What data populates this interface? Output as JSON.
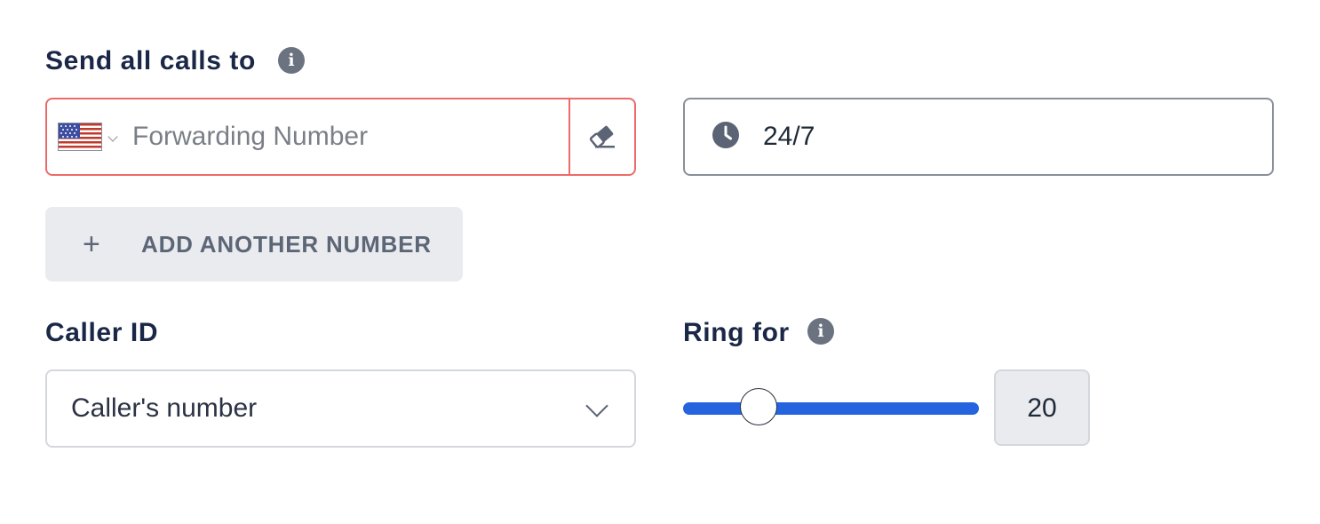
{
  "forwarding": {
    "section_label": "Send all calls to",
    "info_icon": "info-icon",
    "country_flag": "us-flag",
    "number_placeholder": "Forwarding Number",
    "number_value": "",
    "clear_icon": "eraser-icon",
    "error_border_color": "#ec6b6b"
  },
  "schedule": {
    "icon": "clock-icon",
    "value": "24/7"
  },
  "add_number": {
    "icon": "plus-icon",
    "plus_glyph": "+",
    "label": "ADD ANOTHER NUMBER"
  },
  "caller_id": {
    "label": "Caller ID",
    "selected": "Caller's number",
    "chevron_icon": "chevron-down-icon"
  },
  "ring_for": {
    "label": "Ring for",
    "info_icon": "info-icon",
    "value": "20",
    "slider_fraction": 0.26,
    "accent_color": "#2563df"
  }
}
